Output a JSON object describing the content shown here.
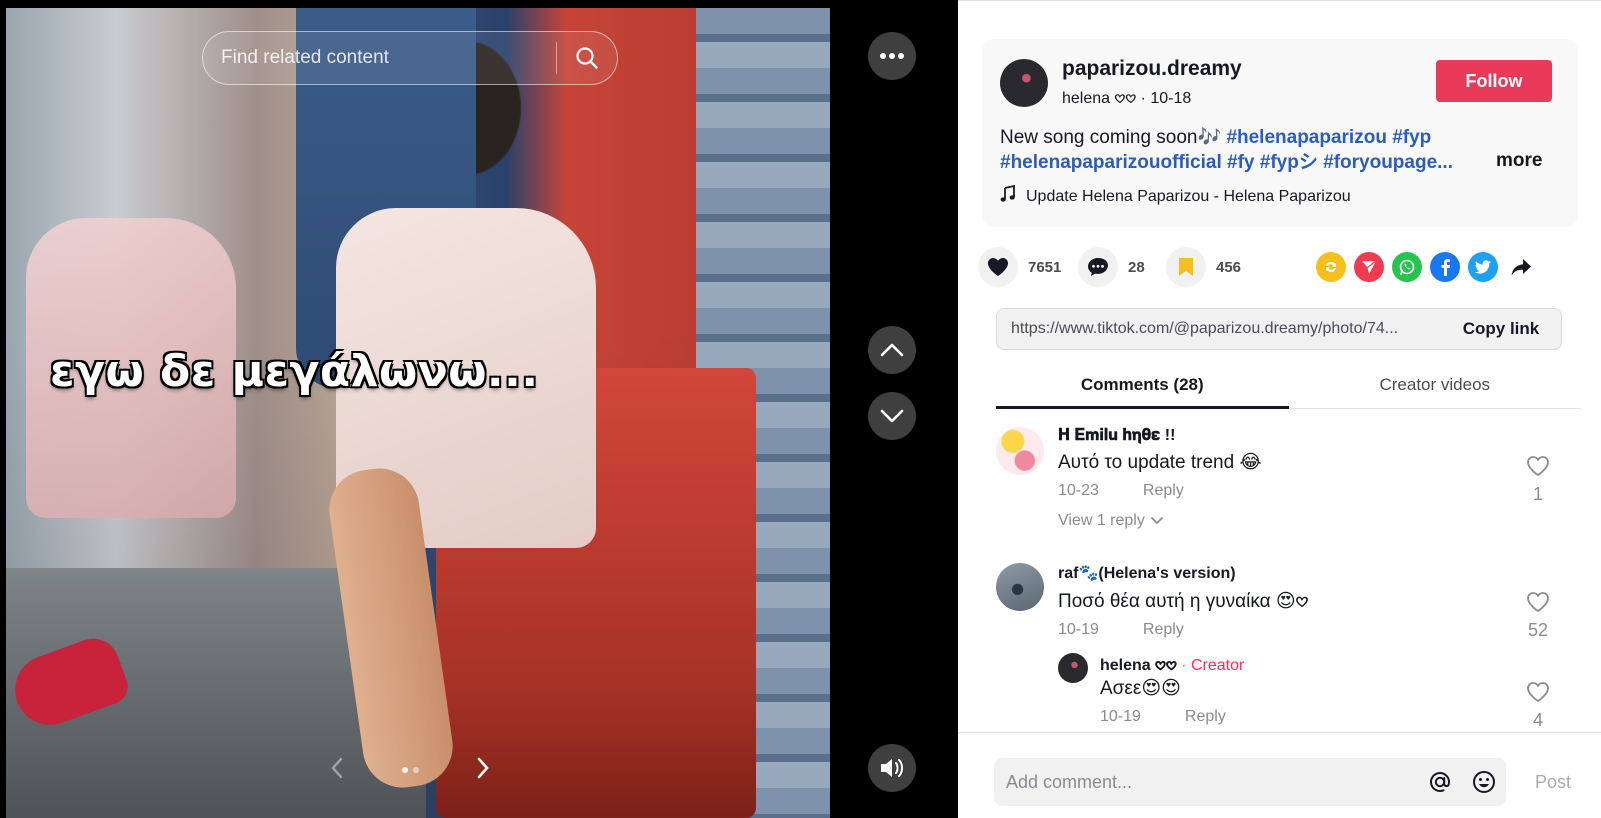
{
  "media": {
    "search_placeholder": "Find related content",
    "overlay_text": "εγω δε μεγάλωνω...",
    "carousel": {
      "total_slides": 2,
      "active_slide": 1
    }
  },
  "post": {
    "username": "paparizou.dreamy",
    "author_name": "helena 𖹭𖹭",
    "date": "10-18",
    "follow_label": "Follow",
    "caption_text": "New song coming soon🎶 ",
    "hashtags": [
      "#helenapaparizou",
      "#fyp",
      "#helenapaparizouofficial",
      "#fy",
      "#fypシ",
      "#foryoupage..."
    ],
    "more_label": "more",
    "music": "Update Helena Paparizou - Helena Paparizou"
  },
  "actions": {
    "likes": "7651",
    "comments": "28",
    "saves": "456",
    "share_icons": [
      "repost-icon",
      "send-icon",
      "whatsapp-icon",
      "facebook-icon",
      "twitter-icon",
      "share-arrow-icon"
    ],
    "colors": {
      "repost": "#f6c01c",
      "send": "#f03c50",
      "whatsapp": "#25c44d",
      "facebook": "#1877f2",
      "twitter": "#1da1f2"
    }
  },
  "link": {
    "url": "https://www.tiktok.com/@paparizou.dreamy/photo/74...",
    "copy_label": "Copy link"
  },
  "tabs": [
    {
      "label": "Comments (28)",
      "active": true
    },
    {
      "label": "Creator videos",
      "active": false
    }
  ],
  "comments": [
    {
      "user": "𝐇 𝐄𝐦𝐢𝐥𝐮 𝐡𝛈𝛉𝛆 !!",
      "text": "Αυτό το update trend 😂",
      "date": "10-23",
      "reply_label": "Reply",
      "likes": "1",
      "view_replies": "View 1 reply"
    },
    {
      "user": "raf🐾(Helena's version)",
      "text": "Ποσό θέα αυτή η γυναίκα 😍𖹭",
      "date": "10-19",
      "reply_label": "Reply",
      "likes": "52"
    },
    {
      "user": "helena 𖹭𖹭",
      "creator_tag": "Creator",
      "separator": " · ",
      "text": "Ασεε😍😍",
      "date": "10-19",
      "reply_label": "Reply",
      "likes": "4"
    }
  ],
  "comment_bar": {
    "placeholder": "Add comment...",
    "post_label": "Post"
  }
}
